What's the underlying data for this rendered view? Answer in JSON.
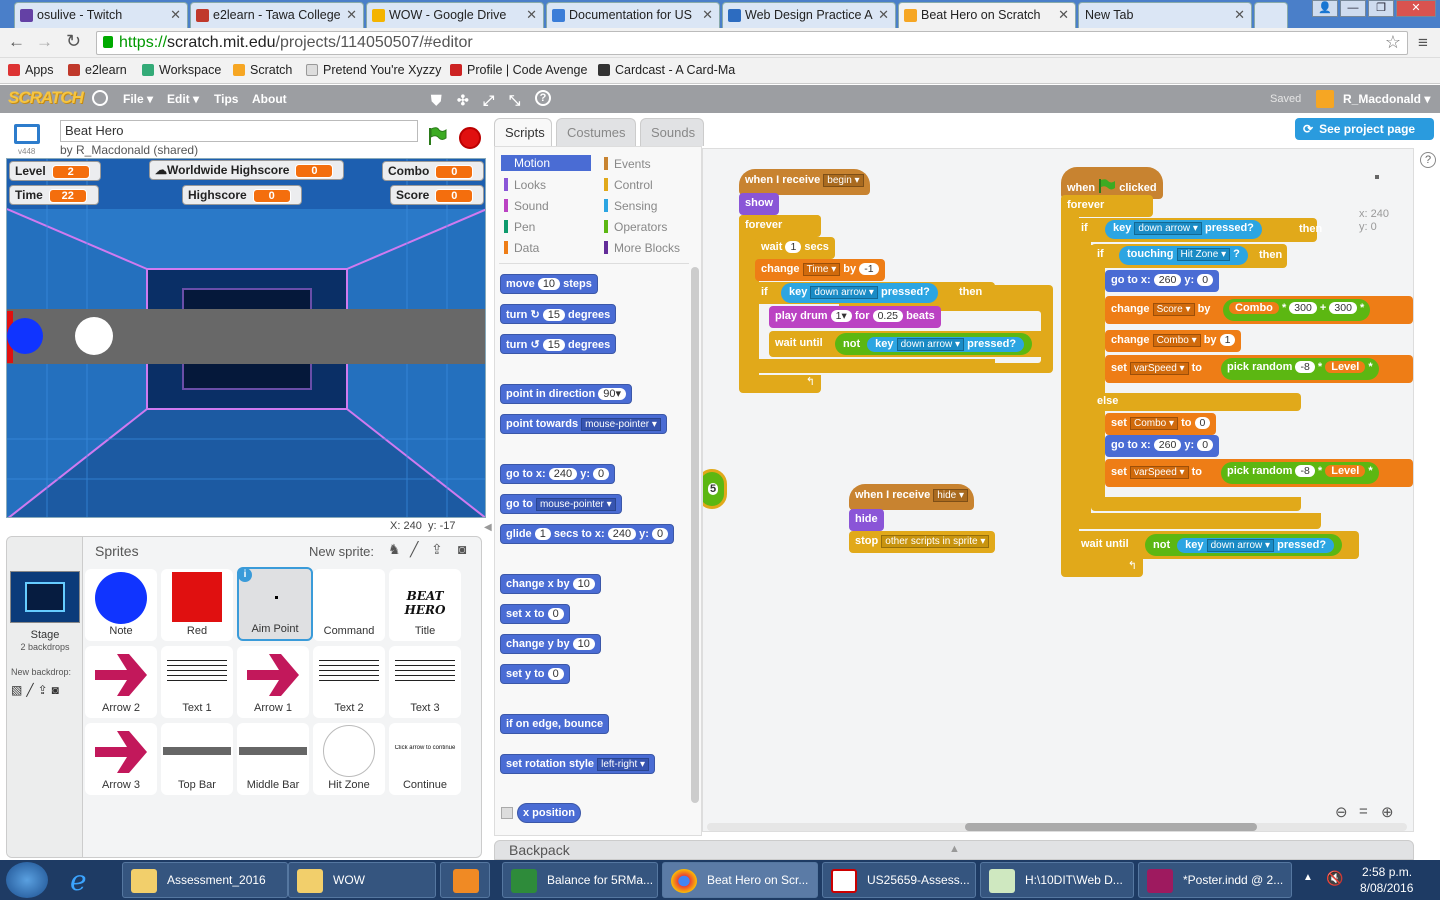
{
  "browser": {
    "tabs": [
      {
        "title": "osulive - Twitch",
        "color": "#6441a5"
      },
      {
        "title": "e2learn - Tawa College",
        "color": "#c0392b"
      },
      {
        "title": "WOW - Google Drive",
        "color": "#f4b400"
      },
      {
        "title": "Documentation for US",
        "color": "#3b7dd8"
      },
      {
        "title": "Web Design Practice A",
        "color": "#2d6cc0"
      },
      {
        "title": "Beat Hero on Scratch",
        "color": "#f6a623"
      },
      {
        "title": "New Tab",
        "color": "#ffffff"
      }
    ],
    "url_secure": "https://",
    "url_host": "scratch.mit.edu",
    "url_path": "/projects/114050507/#editor",
    "bookmarks": [
      "Apps",
      "e2learn",
      "Workspace",
      "Scratch",
      "Pretend You're Xyzzy",
      "Profile | Code Avenge",
      "Cardcast - A Card-Ma"
    ]
  },
  "scratch_menu": {
    "logo": "SCRATCH",
    "items": [
      "File ▾",
      "Edit ▾",
      "Tips",
      "About"
    ],
    "saved": "Saved",
    "user": "R_Macdonald ▾"
  },
  "project": {
    "title": "Beat Hero",
    "author": "by R_Macdonald (shared)",
    "version": "v448"
  },
  "monitors": {
    "level": {
      "label": "Level",
      "value": "2"
    },
    "worldwide": {
      "label": "Worldwide Highscore",
      "value": "0"
    },
    "combo": {
      "label": "Combo",
      "value": "0"
    },
    "time": {
      "label": "Time",
      "value": "22"
    },
    "highscore": {
      "label": "Highscore",
      "value": "0"
    },
    "score": {
      "label": "Score",
      "value": "0"
    }
  },
  "stage_coords": {
    "x_label": "X:",
    "x": "240",
    "y_label": "y:",
    "y": "-17"
  },
  "sprites": {
    "title": "Sprites",
    "new_sprite": "New sprite:",
    "stage_label": "Stage",
    "backdrops": "2 backdrops",
    "new_backdrop": "New backdrop:",
    "items": [
      "Note",
      "Red",
      "Aim Point",
      "Command",
      "Title",
      "Arrow 2",
      "Text 1",
      "Arrow 1",
      "Text 2",
      "Text 3",
      "Arrow 3",
      "Top Bar",
      "Middle Bar",
      "Hit Zone",
      "Continue"
    ],
    "title_art": "BEAT HERO",
    "continue_art": "Click arrow to continue"
  },
  "editor_tabs": [
    "Scripts",
    "Costumes",
    "Sounds"
  ],
  "see_project": "See project page",
  "categories": [
    {
      "name": "Motion",
      "color": "#4a6cd4"
    },
    {
      "name": "Events",
      "color": "#c88330"
    },
    {
      "name": "Looks",
      "color": "#8a55d7"
    },
    {
      "name": "Control",
      "color": "#e1a91a"
    },
    {
      "name": "Sound",
      "color": "#bb42c3"
    },
    {
      "name": "Sensing",
      "color": "#2ca5e2"
    },
    {
      "name": "Pen",
      "color": "#0e9a6c"
    },
    {
      "name": "Operators",
      "color": "#5cb712"
    },
    {
      "name": "Data",
      "color": "#ee7d16"
    },
    {
      "name": "More Blocks",
      "color": "#632d99"
    }
  ],
  "palette": {
    "move": [
      "move",
      "10",
      "steps"
    ],
    "turn_r": [
      "turn ↻",
      "15",
      "degrees"
    ],
    "turn_l": [
      "turn ↺",
      "15",
      "degrees"
    ],
    "point_dir": [
      "point in direction",
      "90▾"
    ],
    "point_towards": [
      "point towards",
      "mouse-pointer ▾"
    ],
    "goto_xy": [
      "go to x:",
      "240",
      "y:",
      "0"
    ],
    "goto": [
      "go to",
      "mouse-pointer ▾"
    ],
    "glide": [
      "glide",
      "1",
      "secs to x:",
      "240",
      "y:",
      "0"
    ],
    "change_x": [
      "change x by",
      "10"
    ],
    "set_x": [
      "set x to",
      "0"
    ],
    "change_y": [
      "change y by",
      "10"
    ],
    "set_y": [
      "set y to",
      "0"
    ],
    "bounce": "if on edge, bounce",
    "rot_style": [
      "set rotation style",
      "left-right ▾"
    ],
    "x_pos": "x position"
  },
  "script1": {
    "hat": [
      "when I receive",
      "begin ▾"
    ],
    "show": "show",
    "forever": "forever",
    "wait": [
      "wait",
      "1",
      "secs"
    ],
    "change_time": [
      "change",
      "Time ▾",
      "by",
      "-1"
    ],
    "if": "if",
    "key": [
      "key",
      "down arrow ▾",
      "pressed?"
    ],
    "then": "then",
    "drum": [
      "play drum",
      "1▾",
      "for",
      "0.25",
      "beats"
    ],
    "wait_until": [
      "wait until",
      "not"
    ]
  },
  "script2": {
    "hat": [
      "when I receive",
      "hide ▾"
    ],
    "hide": "hide",
    "stop": [
      "stop",
      "other scripts in sprite ▾"
    ]
  },
  "script3": {
    "hat": [
      "when",
      "clicked"
    ],
    "forever": "forever",
    "if": "if",
    "key": [
      "key",
      "down arrow ▾",
      "pressed?"
    ],
    "then": "then",
    "touching": [
      "touching",
      "Hit Zone ▾",
      "?"
    ],
    "goto": [
      "go to x:",
      "260",
      "y:",
      "0"
    ],
    "change_score": [
      "change",
      "Score ▾",
      "by",
      "Combo",
      "*",
      "300",
      "+",
      "300",
      "*"
    ],
    "change_combo": [
      "change",
      "Combo ▾",
      "by",
      "1"
    ],
    "set_speed": [
      "set",
      "varSpeed ▾",
      "to",
      "pick random",
      "-8",
      "*",
      "Level",
      "*"
    ],
    "else": "else",
    "set_combo": [
      "set",
      "Combo ▾",
      "to",
      "0"
    ],
    "wait_until": [
      "wait until",
      "not",
      "key",
      "down arrow ▾",
      "pressed?"
    ]
  },
  "script_coords": {
    "x": "x: 240",
    "y": "y: 0"
  },
  "partial_block": "5",
  "backpack": "Backpack",
  "taskbar": {
    "items": [
      "Assessment_2016",
      "WOW",
      "",
      "Balance for 5RMa...",
      "Beat Hero on Scr...",
      "US25659-Assess...",
      "H:\\10DIT\\Web D...",
      "*Poster.indd @ 2..."
    ],
    "time": "2:58 p.m.",
    "date": "8/08/2016"
  }
}
